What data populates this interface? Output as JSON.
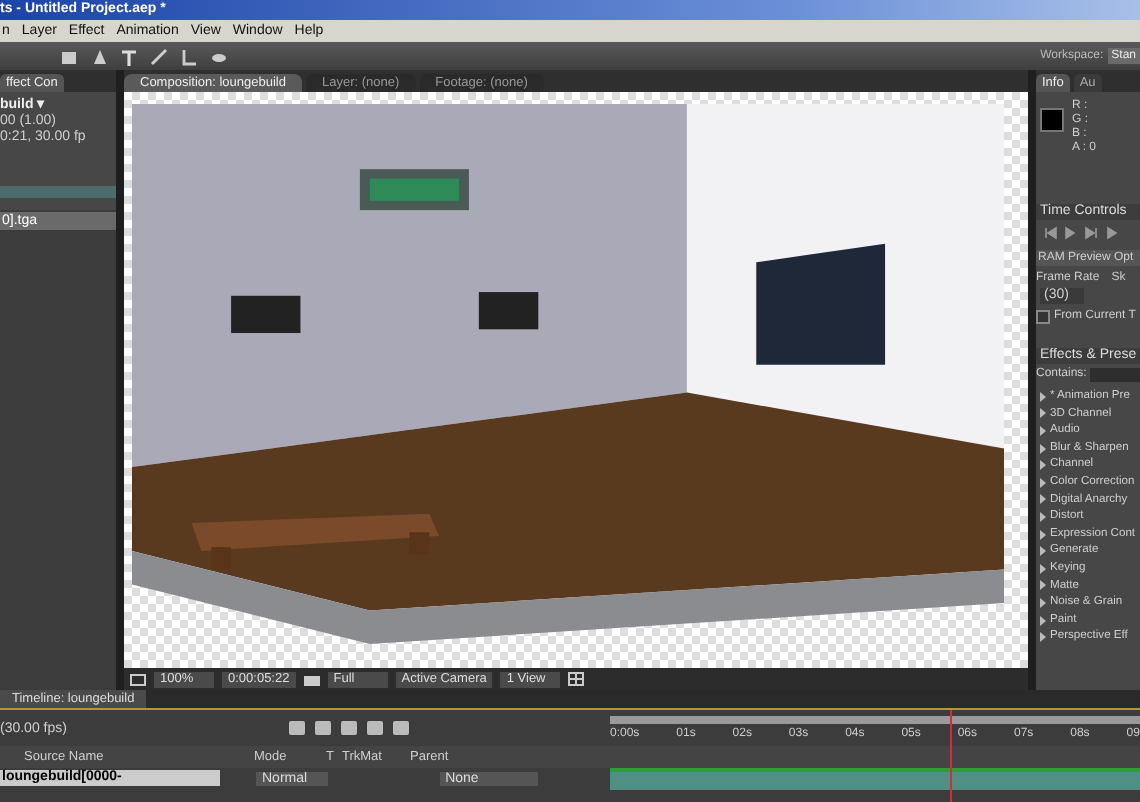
{
  "window": {
    "title": "ts - Untitled Project.aep *"
  },
  "menu": [
    "n",
    "Layer",
    "Effect",
    "Animation",
    "View",
    "Window",
    "Help"
  ],
  "toolbar": {
    "workspace_label": "Workspace:",
    "workspace_value": "Stan"
  },
  "left_panel": {
    "tab": "ffect Con",
    "comp_name": "build ▾",
    "lines": [
      "00 (1.00)",
      "0:21, 30.00 fp"
    ],
    "items": [
      {
        "label": "0].tga",
        "selected": true
      }
    ]
  },
  "viewer": {
    "tabs": [
      {
        "label": "Composition: loungebuild",
        "selected": true
      },
      {
        "label": "Layer: (none)",
        "selected": false
      },
      {
        "label": "Footage: (none)",
        "selected": false
      }
    ],
    "controls": {
      "zoom": "100%",
      "timecode": "0:00:05:22",
      "resolution": "Full",
      "camera": "Active Camera",
      "views": "1 View"
    }
  },
  "right_panel": {
    "info_tabs": [
      {
        "label": "Info",
        "selected": true
      },
      {
        "label": "Au",
        "selected": false
      }
    ],
    "info_values": [
      "R :",
      "G :",
      "B :",
      "A : 0"
    ],
    "time_controls": "Time Controls",
    "ram_preview": "RAM Preview Opt",
    "frame_rate_label": "Frame Rate",
    "skip_label": "Sk",
    "frame_rate": "(30)",
    "from_current": {
      "label": "From Current T",
      "checked": false
    },
    "effects_title": "Effects & Prese",
    "contains_label": "Contains:",
    "categories": [
      "* Animation Pre",
      "3D Channel",
      "Audio",
      "Blur & Sharpen",
      "Channel",
      "Color Correction",
      "Digital Anarchy",
      "Distort",
      "Expression Cont",
      "Generate",
      "Keying",
      "Matte",
      "Noise & Grain",
      "Paint",
      "Perspective Eff"
    ]
  },
  "timeline": {
    "tab": "Timeline: loungebuild",
    "fps": "(30.00 fps)",
    "columns": [
      "Source Name",
      "Mode",
      "T",
      "TrkMat",
      "Parent"
    ],
    "ruler": [
      "0:00s",
      "01s",
      "02s",
      "03s",
      "04s",
      "05s",
      "06s",
      "07s",
      "08s",
      "09"
    ],
    "playhead": {
      "level": 0.64
    },
    "layers": [
      {
        "name": "loungebuild[0000-",
        "mode": "Normal",
        "parent": "None"
      }
    ]
  }
}
